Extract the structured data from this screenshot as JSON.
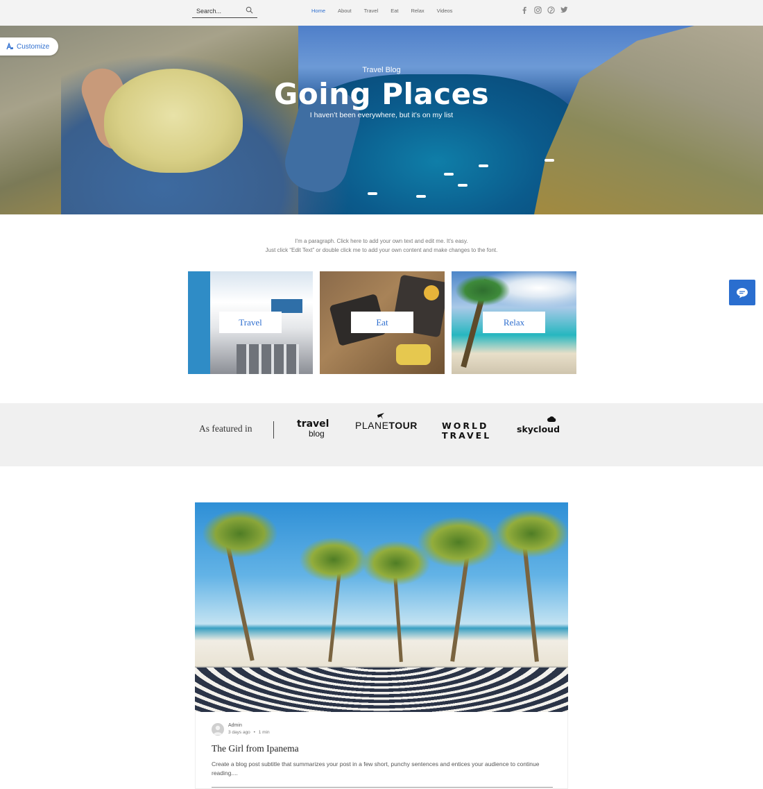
{
  "header": {
    "search_placeholder": "Search...",
    "nav": [
      "Home",
      "About",
      "Travel",
      "Eat",
      "Relax",
      "Videos"
    ],
    "active_nav": "Home",
    "social_icons": [
      "facebook-icon",
      "instagram-icon",
      "pinterest-icon",
      "twitter-icon"
    ]
  },
  "customize": {
    "label": "Customize"
  },
  "hero": {
    "subtitle": "Travel Blog",
    "title": "Going Places",
    "tagline": "I haven’t been everywhere, but it’s on my list"
  },
  "intro": {
    "line1": "I'm a paragraph. Click here to add your own text and edit me. It’s easy.",
    "line2": "Just click “Edit Text” or double click me to add your own content and make changes to the font."
  },
  "categories": [
    {
      "label": "Travel"
    },
    {
      "label": "Eat"
    },
    {
      "label": "Relax"
    }
  ],
  "featured": {
    "label": "As featured in",
    "logos": {
      "travel_top": "travel",
      "travel_bottom": "blog",
      "plane_a": "PLANE",
      "plane_b": "TOUR",
      "world_top": "WORLD",
      "world_bottom": "TRAVEL",
      "sky": "skycloud"
    }
  },
  "post": {
    "author": "Admin",
    "time": "3 days ago",
    "read": "1 min",
    "separator": "•",
    "title": "The Girl from Ipanema",
    "excerpt": "Create a blog post subtitle that summarizes your post in a few short, punchy sentences and entices your audience to continue reading...."
  },
  "colors": {
    "accent": "#2f6fcf",
    "header_bg": "#f3f3f3",
    "featured_bg": "#f0f0f0",
    "chat_bg": "#2a6ecf"
  }
}
